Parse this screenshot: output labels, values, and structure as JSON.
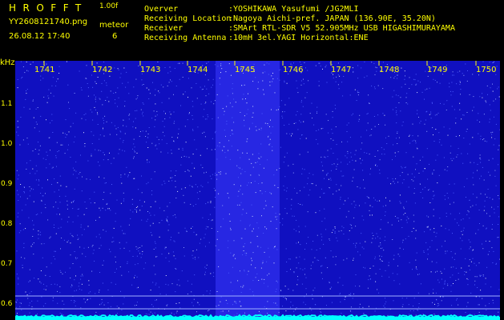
{
  "header": {
    "title": "HROFFT",
    "version": "1.00f",
    "filename": "YY2608121740.png",
    "mode_label": "meteor",
    "datetime": "26.08.12 17:40",
    "count": "6",
    "info": [
      {
        "label": "Overver",
        "value": ":YOSHIKAWA Yasufumi /JG2MLI"
      },
      {
        "label": "Receiving Location",
        "value": ":Nagoya Aichi-pref. JAPAN (136.90E, 35.20N)"
      },
      {
        "label": "Receiver",
        "value": ":SMArt RTL-SDR V5 52.905MHz USB HIGASHIMURAYAMA"
      },
      {
        "label": "Receiving Antenna",
        "value": ":10mH 3el.YAGI Horizontal:ENE"
      }
    ]
  },
  "axis": {
    "y_unit": "kHz",
    "y_ticks": [
      "1.1",
      "1.0",
      "0.9",
      "0.8",
      "0.7",
      "0.6"
    ],
    "x_ticks": [
      "1741",
      "1742",
      "1743",
      "1744",
      "1745",
      "1746",
      "1747",
      "1748",
      "1749",
      "1750"
    ]
  },
  "colors": {
    "background": "#000000",
    "label": "#ffff00",
    "info": "#ffff66",
    "spectrum": "#1010c0",
    "noise_band": "#3a3aff",
    "baseline": "#00ffff"
  }
}
